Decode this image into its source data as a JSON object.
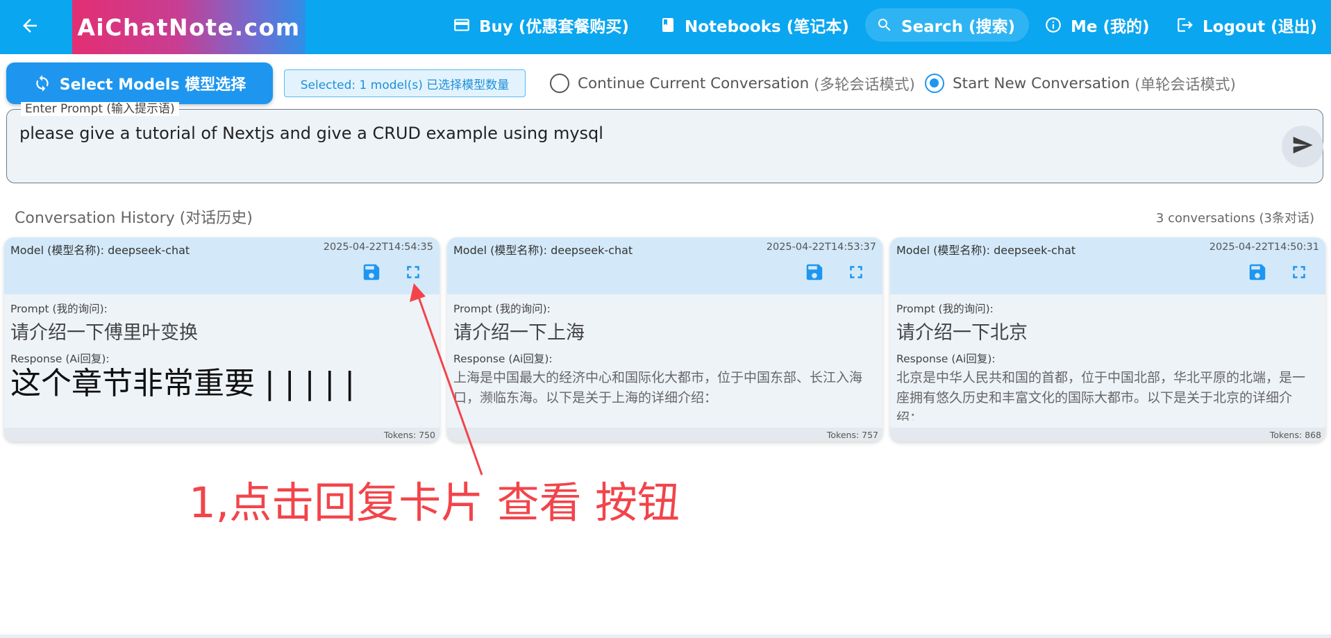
{
  "header": {
    "logo": "AiChatNote.com",
    "nav": {
      "buy": "Buy (优惠套餐购买)",
      "notebooks": "Notebooks (笔记本)",
      "search": "Search (搜索)",
      "me": "Me (我的)",
      "logout": "Logout (退出)"
    },
    "icons": {
      "back": "arrow-left-icon",
      "buy": "credit-card-icon",
      "notebooks": "book-icon",
      "search": "search-icon",
      "me": "info-icon",
      "logout": "logout-icon"
    }
  },
  "controls": {
    "select_models": "Select Models 模型选择",
    "selected_badge": "Selected: 1 model(s) 已选择模型数量",
    "radio_continue": {
      "label": "Continue Current Conversation",
      "sub": "(多轮会话模式)",
      "checked": false
    },
    "radio_new": {
      "label": "Start New Conversation",
      "sub": "(单轮会话模式)",
      "checked": true
    }
  },
  "prompt": {
    "legend": "Enter Prompt (输入提示语)",
    "value": "please give a tutorial of Nextjs and give a CRUD example using mysql"
  },
  "history": {
    "title": "Conversation History (对话历史)",
    "count": "3 conversations (3条对话)",
    "prompt_label": "Prompt (我的询问):",
    "response_label": "Response (Ai回复):",
    "cards": [
      {
        "model": "Model (模型名称): deepseek-chat",
        "timestamp": "2025-04-22T14:54:35",
        "prompt": "请介绍一下傅里叶变换",
        "response": "这个章节非常重要 | | | | |",
        "tokens": "Tokens: 750"
      },
      {
        "model": "Model (模型名称): deepseek-chat",
        "timestamp": "2025-04-22T14:53:37",
        "prompt": "请介绍一下上海",
        "response": "上海是中国最大的经济中心和国际化大都市，位于中国东部、长江入海口，濒临东海。以下是关于上海的详细介绍：",
        "tokens": "Tokens: 757"
      },
      {
        "model": "Model (模型名称): deepseek-chat",
        "timestamp": "2025-04-22T14:50:31",
        "prompt": "请介绍一下北京",
        "response": "北京是中华人民共和国的首都，位于中国北部，华北平原的北端，是一座拥有悠久历史和丰富文化的国际大都市。以下是关于北京的详细介绍：",
        "tokens": "Tokens: 868"
      }
    ]
  },
  "annotation": {
    "text": "1,点击回复卡片 查看 按钮",
    "color": "#f2444a"
  },
  "colors": {
    "topbar": "#0aa6f0",
    "accent": "#1e96f0",
    "card_header": "#d3e9f9"
  }
}
